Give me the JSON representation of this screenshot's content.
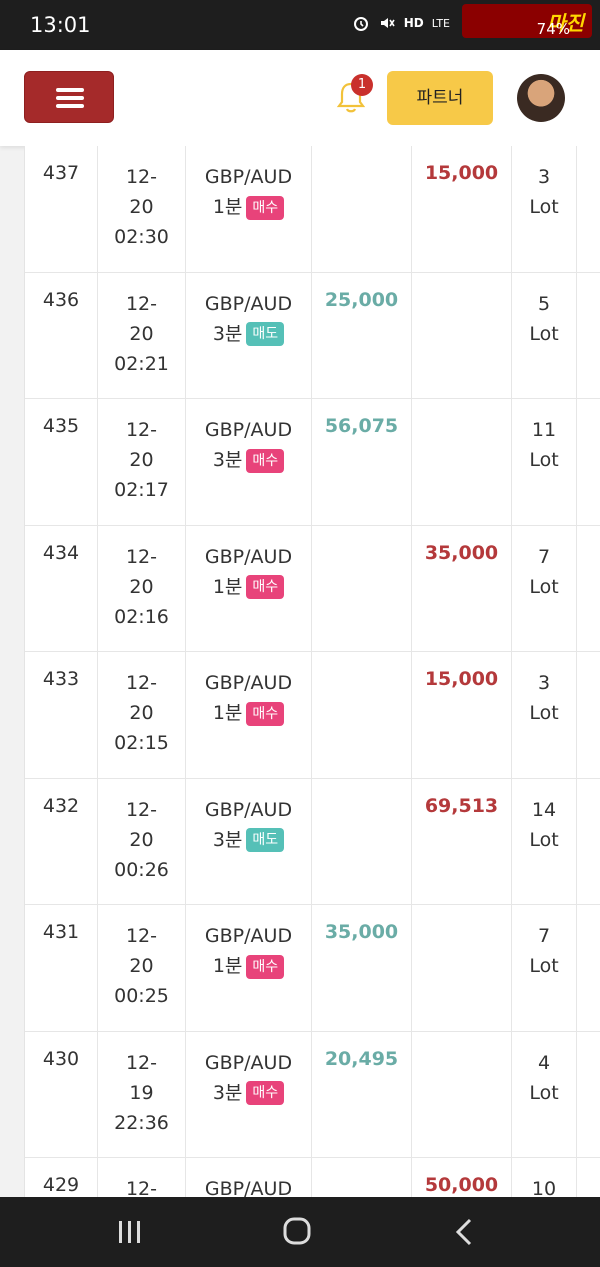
{
  "status_bar": {
    "time": "13:01",
    "battery": "74%",
    "icons": [
      "alarm-icon",
      "mute-icon",
      "hd-voice-icon",
      "lte-icon",
      "signal-icon",
      "battery-icon"
    ],
    "watermark": "마진"
  },
  "header": {
    "notification_count": "1",
    "partner_label": "파트너"
  },
  "table": {
    "rows": [
      {
        "no": "437",
        "date1": "12-",
        "date2": "20",
        "time": "02:30",
        "pair": "GBP/AUD",
        "duration": "1분",
        "side": "매수",
        "side_type": "buy",
        "profit": "",
        "loss": "15,000",
        "lot_n": "3",
        "lot_u": "Lot"
      },
      {
        "no": "436",
        "date1": "12-",
        "date2": "20",
        "time": "02:21",
        "pair": "GBP/AUD",
        "duration": "3분",
        "side": "매도",
        "side_type": "sell",
        "profit": "25,000",
        "loss": "",
        "lot_n": "5",
        "lot_u": "Lot"
      },
      {
        "no": "435",
        "date1": "12-",
        "date2": "20",
        "time": "02:17",
        "pair": "GBP/AUD",
        "duration": "3분",
        "side": "매수",
        "side_type": "buy",
        "profit": "56,075",
        "loss": "",
        "lot_n": "11",
        "lot_u": "Lot"
      },
      {
        "no": "434",
        "date1": "12-",
        "date2": "20",
        "time": "02:16",
        "pair": "GBP/AUD",
        "duration": "1분",
        "side": "매수",
        "side_type": "buy",
        "profit": "",
        "loss": "35,000",
        "lot_n": "7",
        "lot_u": "Lot"
      },
      {
        "no": "433",
        "date1": "12-",
        "date2": "20",
        "time": "02:15",
        "pair": "GBP/AUD",
        "duration": "1분",
        "side": "매수",
        "side_type": "buy",
        "profit": "",
        "loss": "15,000",
        "lot_n": "3",
        "lot_u": "Lot"
      },
      {
        "no": "432",
        "date1": "12-",
        "date2": "20",
        "time": "00:26",
        "pair": "GBP/AUD",
        "duration": "3분",
        "side": "매도",
        "side_type": "sell",
        "profit": "",
        "loss": "69,513",
        "lot_n": "14",
        "lot_u": "Lot"
      },
      {
        "no": "431",
        "date1": "12-",
        "date2": "20",
        "time": "00:25",
        "pair": "GBP/AUD",
        "duration": "1분",
        "side": "매수",
        "side_type": "buy",
        "profit": "35,000",
        "loss": "",
        "lot_n": "7",
        "lot_u": "Lot"
      },
      {
        "no": "430",
        "date1": "12-",
        "date2": "19",
        "time": "22:36",
        "pair": "GBP/AUD",
        "duration": "3분",
        "side": "매수",
        "side_type": "buy",
        "profit": "20,495",
        "loss": "",
        "lot_n": "4",
        "lot_u": "Lot"
      },
      {
        "no": "429",
        "date1": "12-",
        "date2": "",
        "time": "",
        "pair": "GBP/AUD",
        "duration": "",
        "side": "",
        "side_type": "",
        "profit": "",
        "loss": "50,000",
        "lot_n": "10",
        "lot_u": ""
      }
    ]
  },
  "colors": {
    "profit": "#6aaca6",
    "loss": "#b4393b",
    "buy_tag": "#e8437a",
    "sell_tag": "#55c0b7",
    "menu_button": "#a52a2a",
    "partner_button": "#f7c948"
  },
  "nav": [
    "recent-apps-icon",
    "home-icon",
    "back-icon"
  ]
}
